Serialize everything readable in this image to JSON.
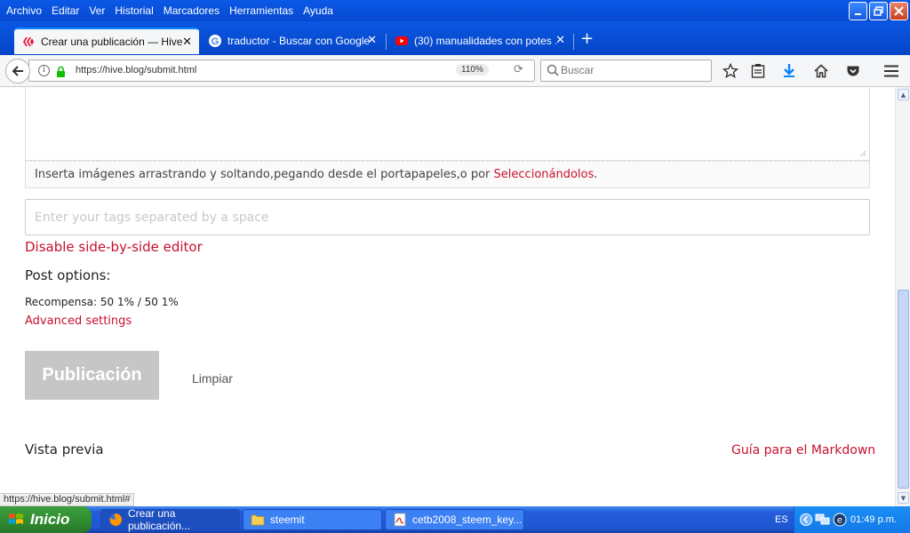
{
  "menubar": {
    "items": [
      "Archivo",
      "Editar",
      "Ver",
      "Historial",
      "Marcadores",
      "Herramientas",
      "Ayuda"
    ]
  },
  "tabs": [
    {
      "label": "Crear una publicación — Hive",
      "active": true,
      "icon": "hive-icon"
    },
    {
      "label": "traductor - Buscar con Google",
      "active": false,
      "icon": "google-icon"
    },
    {
      "label": "(30) manualidades con potes ...",
      "active": false,
      "icon": "youtube-icon"
    }
  ],
  "navbar": {
    "url": "https://hive.blog/submit.html",
    "zoom": "110%",
    "search_placeholder": "Buscar"
  },
  "editor": {
    "dropzone_text": "Inserta imágenes arrastrando y soltando,pegando desde el portapapeles,o por ",
    "dropzone_link": "Seleccionándolos",
    "dropzone_end": ".",
    "tags_placeholder": "Enter your tags separated by a space",
    "disable_side_by_side": "Disable side-by-side editor",
    "post_options_label": "Post options:",
    "reward_text": "Recompensa: 50 1% / 50 1%",
    "advanced_settings": "Advanced settings",
    "publish_label": "Publicación",
    "clear_label": "Limpiar",
    "preview_label": "Vista previa",
    "markdown_guide": "Guía para el Markdown"
  },
  "statusbar": {
    "text": "https://hive.blog/submit.html#"
  },
  "taskbar": {
    "start_label": "Inicio",
    "tasks": [
      {
        "label": "Crear una publicación...",
        "icon": "firefox-icon"
      },
      {
        "label": "steemit",
        "icon": "folder-icon"
      },
      {
        "label": "cetb2008_steem_key...",
        "icon": "pdf-icon"
      }
    ],
    "lang": "ES",
    "clock": "01:49 p.m."
  },
  "colors": {
    "accent_red": "#c8102e",
    "xp_blue": "#0649d0",
    "start_green": "#2f8a2f",
    "button_disabled": "#c6c6c6"
  }
}
